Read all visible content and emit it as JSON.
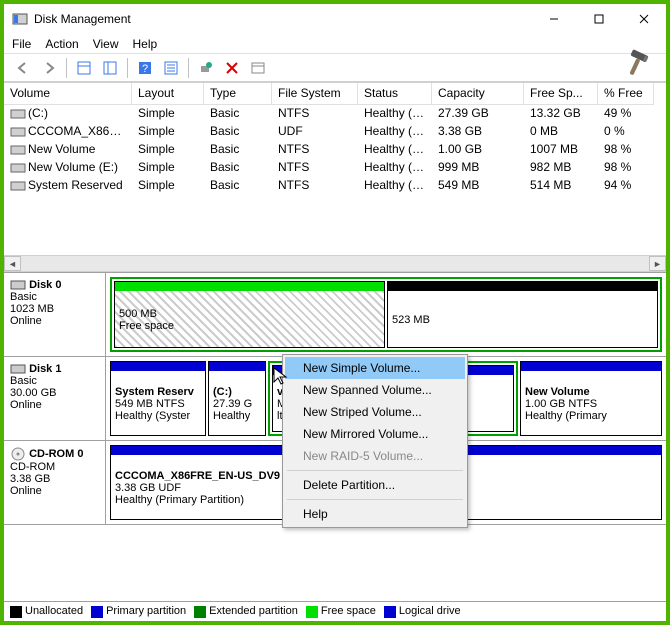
{
  "title": "Disk Management",
  "menu": {
    "file": "File",
    "action": "Action",
    "view": "View",
    "help": "Help"
  },
  "columns": {
    "volume": "Volume",
    "layout": "Layout",
    "type": "Type",
    "filesystem": "File System",
    "status": "Status",
    "capacity": "Capacity",
    "freespace": "Free Sp...",
    "percentfree": "% Free"
  },
  "volumes": [
    {
      "name": "(C:)",
      "layout": "Simple",
      "type": "Basic",
      "fs": "NTFS",
      "status": "Healthy (B...",
      "capacity": "27.39 GB",
      "free": "13.32 GB",
      "pct": "49 %"
    },
    {
      "name": "CCCOMA_X86FRE...",
      "layout": "Simple",
      "type": "Basic",
      "fs": "UDF",
      "status": "Healthy (P...",
      "capacity": "3.38 GB",
      "free": "0 MB",
      "pct": "0 %"
    },
    {
      "name": "New Volume",
      "layout": "Simple",
      "type": "Basic",
      "fs": "NTFS",
      "status": "Healthy (P...",
      "capacity": "1.00 GB",
      "free": "1007 MB",
      "pct": "98 %"
    },
    {
      "name": "New Volume (E:)",
      "layout": "Simple",
      "type": "Basic",
      "fs": "NTFS",
      "status": "Healthy (L...",
      "capacity": "999 MB",
      "free": "982 MB",
      "pct": "98 %"
    },
    {
      "name": "System Reserved",
      "layout": "Simple",
      "type": "Basic",
      "fs": "NTFS",
      "status": "Healthy (S...",
      "capacity": "549 MB",
      "free": "514 MB",
      "pct": "94 %"
    }
  ],
  "disk0": {
    "name": "Disk 0",
    "type": "Basic",
    "size": "1023 MB",
    "state": "Online",
    "part1_size": "500 MB",
    "part1_label": "Free space",
    "part2_size": "523 MB"
  },
  "disk1": {
    "name": "Disk 1",
    "type": "Basic",
    "size": "30.00 GB",
    "state": "Online",
    "p1_name": "System Reserv",
    "p1_l1": "549 MB NTFS",
    "p1_l2": "Healthy (Syster",
    "p2_name": "(C:)",
    "p2_l1": "27.39 G",
    "p2_l2": "Healthy",
    "p3_name": "v Volume  (",
    "p3_l1": "MB NTFS",
    "p3_l2": "lthy (Logica",
    "p4_name": "New Volume",
    "p4_l1": "1.00 GB NTFS",
    "p4_l2": "Healthy (Primary"
  },
  "cdrom": {
    "name": "CD-ROM 0",
    "type": "CD-ROM",
    "size": "3.38 GB",
    "state": "Online",
    "p_name": "CCCOMA_X86FRE_EN-US_DV9 (D:)",
    "p_l1": "3.38 GB UDF",
    "p_l2": "Healthy (Primary Partition)"
  },
  "ctx": {
    "simple": "New Simple Volume...",
    "spanned": "New Spanned Volume...",
    "striped": "New Striped Volume...",
    "mirrored": "New Mirrored Volume...",
    "raid5": "New RAID-5 Volume...",
    "delete": "Delete Partition...",
    "help": "Help"
  },
  "legend": {
    "unalloc": "Unallocated",
    "primary": "Primary partition",
    "extended": "Extended partition",
    "freespace": "Free space",
    "logical": "Logical drive"
  }
}
